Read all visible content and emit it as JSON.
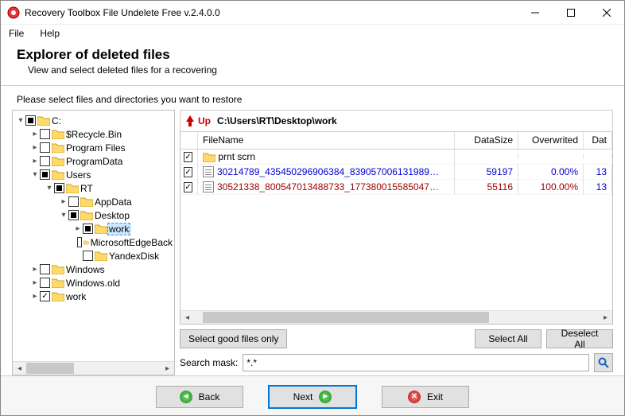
{
  "window": {
    "title": "Recovery Toolbox File Undelete Free v.2.4.0.0"
  },
  "menu": {
    "file": "File",
    "help": "Help"
  },
  "header": {
    "title": "Explorer of deleted files",
    "subtitle": "View and select deleted files for a recovering"
  },
  "instruction": "Please select files and directories you want to restore",
  "tree": {
    "root": "C:",
    "nodes": [
      "$Recycle.Bin",
      "Program Files",
      "ProgramData",
      "Users",
      "RT",
      "AppData",
      "Desktop",
      "work",
      "MicrosoftEdgeBack",
      "YandexDisk",
      "Windows",
      "Windows.old",
      "work"
    ]
  },
  "path": {
    "up_label": "Up",
    "current": "C:\\Users\\RT\\Desktop\\work"
  },
  "grid": {
    "headers": {
      "filename": "FileName",
      "datasize": "DataSize",
      "overwrited": "Overwrited",
      "date": "Dat"
    },
    "rows": [
      {
        "type": "folder",
        "name": "prnt scrn",
        "size": "",
        "ovr": "",
        "date": ""
      },
      {
        "type": "file",
        "name": "30214789_435450296906384_839057006131989…",
        "size": "59197",
        "ovr": "0.00%",
        "date": "13",
        "style": "blue"
      },
      {
        "type": "file",
        "name": "30521338_800547013488733_177380015585047…",
        "size": "55116",
        "ovr": "100.00%",
        "date": "13",
        "style": "red"
      }
    ]
  },
  "buttons": {
    "good": "Select good files only",
    "select_all": "Select All",
    "deselect_all": "Deselect All"
  },
  "search": {
    "label": "Search mask:",
    "value": "*.*"
  },
  "nav": {
    "back": "Back",
    "next": "Next",
    "exit": "Exit"
  }
}
